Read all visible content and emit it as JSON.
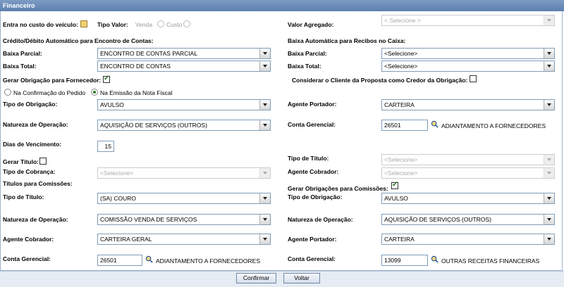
{
  "window": {
    "title": "Financeiro"
  },
  "left": {
    "entra_custo_label": "Entra no custo do veículo:",
    "tipo_valor_label": "Tipo Valor:",
    "tipo_valor_opt1": "Venda",
    "tipo_valor_opt2": "Custo",
    "credito_debito_label": "Crédito/Débito Automático para Encontro de Contas:",
    "baixa_parcial_label": "Baixa Parcial:",
    "baixa_parcial_value": "ENCONTRO DE CONTAS PARCIAL",
    "baixa_total_label": "Baixa Total:",
    "baixa_total_value": "ENCONTRO DE CONTAS",
    "gerar_obrigacao_label": "Gerar Obrigação para Fornecedor:",
    "radio_confirmacao": "Na Confirmação do Pedido",
    "radio_emissao": "Na Emissão da Nota Fiscal",
    "tipo_obrigacao_label": "Tipo de Obrigação:",
    "tipo_obrigacao_value": "AVULSO",
    "natureza_label": "Natureza de Operação:",
    "natureza_value": "AQUISIÇÃO DE SERVIÇOS (OUTROS)",
    "dias_venc_label": "Dias de Vencimento:",
    "dias_venc_value": "15",
    "gerar_titulo_label": "Gerar Título:",
    "tipo_cobranca_label": "Tipo de Cobrança:",
    "tipo_cobranca_value": "<Selecione>",
    "titulos_comissoes_label": "Títulos para Comissões:",
    "tipo_titulo_label": "Tipo de Título:",
    "tipo_titulo_value": "(SA) COURO",
    "natureza2_label": "Natureza de Operação:",
    "natureza2_value": "COMISSÃO VENDA DE SERVIÇOS",
    "agente_cobrador_label": "Agente Cobrador:",
    "agente_cobrador_value": "CARTEIRA GERAL",
    "conta_gerencial_label": "Conta Gerencial:",
    "conta_gerencial_code": "26501",
    "conta_gerencial_desc": "ADIANTAMENTO A FORNECEDORES"
  },
  "right": {
    "valor_agregado_label": "Valor Agregado:",
    "valor_agregado_value": "< Selecione >",
    "baixa_auto_label": "Baixa Automática para Recibos no Caixa:",
    "baixa_parcial_label": "Baixa Parcial:",
    "baixa_parcial_value": "<Selecione>",
    "baixa_total_label": "Baixa Total:",
    "baixa_total_value": "<Selecione>",
    "considerar_cliente_label": "Considerar o Cliente da Proposta como Credor da Obrigação:",
    "agente_portador_label": "Agente Portador:",
    "agente_portador_value": "CARTEIRA",
    "conta_gerencial_label": "Conta Gerencial:",
    "conta_gerencial_code": "26501",
    "conta_gerencial_desc": "ADIANTAMENTO A FORNECEDORES",
    "tipo_titulo_label": "Tipo de Título:",
    "tipo_titulo_value": "<Selecione>",
    "agente_cobrador_label": "Agente Cobrador:",
    "agente_cobrador_value": "<Selecione>",
    "gerar_obrig_comissoes_label": "Gerar Obrigações para Comissões:",
    "tipo_obrigacao_label": "Tipo de Obrigação:",
    "tipo_obrigacao_value": "AVULSO",
    "natureza_label": "Natureza de Operação:",
    "natureza_value": "AQUISIÇÃO DE SERVIÇOS (OUTROS)",
    "agente_portador2_label": "Agente Portador:",
    "agente_portador2_value": "CARTEIRA",
    "conta_gerencial2_label": "Conta Gerencial:",
    "conta_gerencial2_code": "13099",
    "conta_gerencial2_desc": "OUTRAS RECEITAS FINANCEIRAS"
  },
  "footer": {
    "confirm_label": "Confirmar",
    "back_label": "Voltar"
  }
}
